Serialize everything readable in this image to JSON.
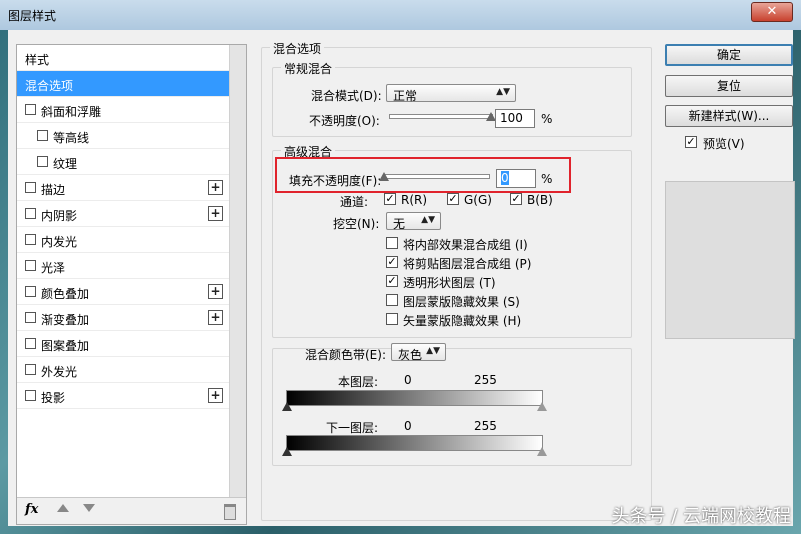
{
  "window": {
    "title": "图层样式",
    "close": "✕"
  },
  "styles_list": {
    "header": "样式",
    "items": [
      {
        "label": "混合选项",
        "checkbox": false,
        "plus": false,
        "indent": 0,
        "selected": true
      },
      {
        "label": "斜面和浮雕",
        "checkbox": true,
        "plus": false,
        "indent": 0
      },
      {
        "label": "等高线",
        "checkbox": true,
        "plus": false,
        "indent": 1
      },
      {
        "label": "纹理",
        "checkbox": true,
        "plus": false,
        "indent": 1
      },
      {
        "label": "描边",
        "checkbox": true,
        "plus": true,
        "indent": 0
      },
      {
        "label": "内阴影",
        "checkbox": true,
        "plus": true,
        "indent": 0
      },
      {
        "label": "内发光",
        "checkbox": true,
        "plus": false,
        "indent": 0
      },
      {
        "label": "光泽",
        "checkbox": true,
        "plus": false,
        "indent": 0
      },
      {
        "label": "颜色叠加",
        "checkbox": true,
        "plus": true,
        "indent": 0
      },
      {
        "label": "渐变叠加",
        "checkbox": true,
        "plus": true,
        "indent": 0
      },
      {
        "label": "图案叠加",
        "checkbox": true,
        "plus": false,
        "indent": 0
      },
      {
        "label": "外发光",
        "checkbox": true,
        "plus": false,
        "indent": 0
      },
      {
        "label": "投影",
        "checkbox": true,
        "plus": true,
        "indent": 0
      }
    ],
    "footer_fx": "fx"
  },
  "blend_options": {
    "section_title": "混合选项",
    "general": {
      "title": "常规混合",
      "mode_label": "混合模式(D):",
      "mode_value": "正常",
      "opacity_label": "不透明度(O):",
      "opacity_value": "100",
      "opacity_unit": "%",
      "opacity_level": 1.0
    },
    "advanced": {
      "title": "高级混合",
      "fill_label": "填充不透明度(F):",
      "fill_value": "0",
      "fill_unit": "%",
      "fill_level": 0.0,
      "channels_label": "通道:",
      "channels": [
        {
          "label": "R(R)",
          "checked": true
        },
        {
          "label": "G(G)",
          "checked": true
        },
        {
          "label": "B(B)",
          "checked": true
        }
      ],
      "knockout_label": "挖空(N):",
      "knockout_value": "无",
      "options": [
        {
          "label": "将内部效果混合成组 (I)",
          "checked": false
        },
        {
          "label": "将剪贴图层混合成组 (P)",
          "checked": true
        },
        {
          "label": "透明形状图层 (T)",
          "checked": true
        },
        {
          "label": "图层蒙版隐藏效果 (S)",
          "checked": false
        },
        {
          "label": "矢量蒙版隐藏效果 (H)",
          "checked": false
        }
      ]
    },
    "blend_if": {
      "label": "混合颜色带(E):",
      "value": "灰色",
      "this_layer_label": "本图层:",
      "this_layer_low": "0",
      "this_layer_high": "255",
      "underlying_label": "下一图层:",
      "underlying_low": "0",
      "underlying_high": "255"
    }
  },
  "buttons": {
    "ok": "确定",
    "reset": "复位",
    "new_style": "新建样式(W)...",
    "preview_label": "预览(V)",
    "preview_checked": true
  },
  "watermark": "头条号 / 云端网校教程",
  "colors": {
    "selection": "#3399ff",
    "highlight_box": "#e0232c"
  }
}
